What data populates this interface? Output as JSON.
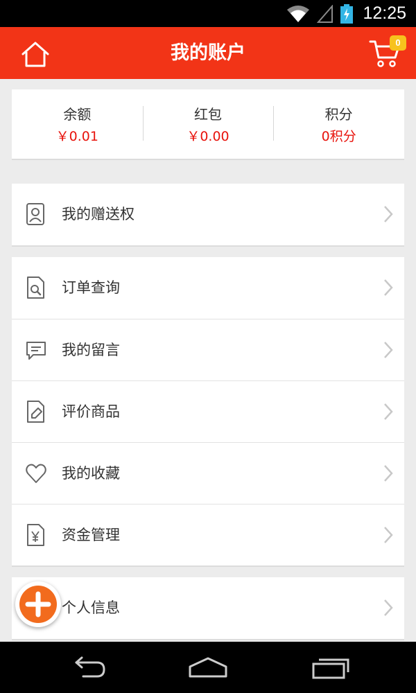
{
  "status_bar": {
    "time": "12:25",
    "icons": [
      "wifi-icon",
      "signal-icon",
      "battery-charging-icon"
    ]
  },
  "header": {
    "title": "我的账户",
    "cart_count": "0",
    "colors": {
      "background": "#f23417",
      "badge": "#f7c21d"
    }
  },
  "stats": [
    {
      "label": "余额",
      "value": "￥0.01"
    },
    {
      "label": "红包",
      "value": "￥0.00"
    },
    {
      "label": "积分",
      "value": "0积分"
    }
  ],
  "menu": {
    "group1": [
      {
        "label": "我的赠送权",
        "icon": "contact-card-icon"
      }
    ],
    "group2": [
      {
        "label": "订单查询",
        "icon": "order-search-icon"
      },
      {
        "label": "我的留言",
        "icon": "message-icon"
      },
      {
        "label": "评价商品",
        "icon": "review-icon"
      },
      {
        "label": "我的收藏",
        "icon": "heart-icon"
      },
      {
        "label": "资金管理",
        "icon": "fund-document-icon"
      }
    ],
    "group3": [
      {
        "label": "个人信息",
        "icon": "person-icon"
      }
    ]
  },
  "fab": {
    "icon": "plus-icon",
    "color": "#f26b1d"
  },
  "navbar": {
    "buttons": [
      "back-icon",
      "home-icon",
      "recent-apps-icon"
    ]
  }
}
